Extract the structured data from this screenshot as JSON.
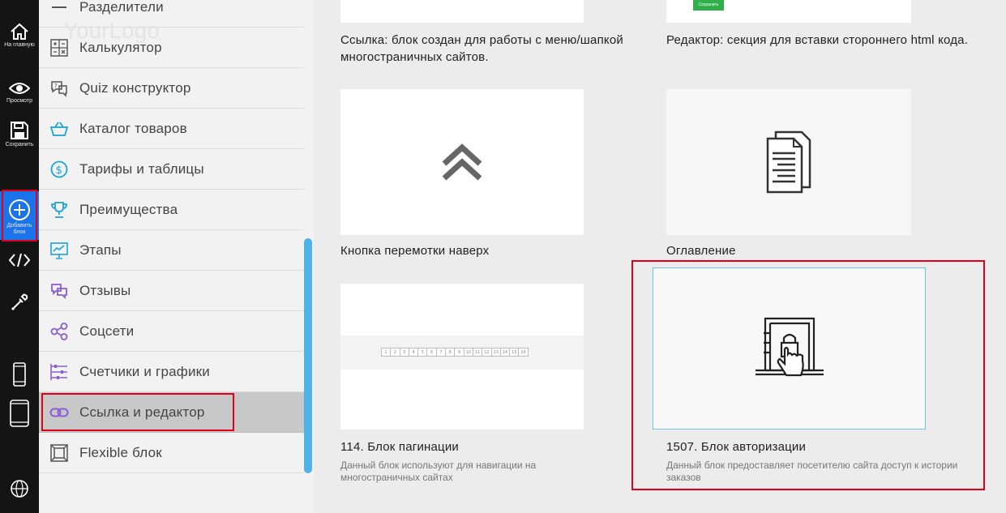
{
  "toolbar": {
    "home_label": "На главную",
    "preview_label": "Просмотр",
    "save_label": "Сохранить",
    "add_block_label": "Добавить блок"
  },
  "categories": [
    {
      "label": "Разделители",
      "icon": "divider-icon"
    },
    {
      "label": "Калькулятор",
      "icon": "calculator-icon"
    },
    {
      "label": "Quiz конструктор",
      "icon": "quiz-icon"
    },
    {
      "label": "Каталог товаров",
      "icon": "basket-icon"
    },
    {
      "label": "Тарифы и таблицы",
      "icon": "dollar-icon"
    },
    {
      "label": "Преимущества",
      "icon": "trophy-icon"
    },
    {
      "label": "Этапы",
      "icon": "chart-board-icon"
    },
    {
      "label": "Отзывы",
      "icon": "chat-icon"
    },
    {
      "label": "Соцсети",
      "icon": "share-icon"
    },
    {
      "label": "Счетчики и графики",
      "icon": "sliders-icon"
    },
    {
      "label": "Ссылка и редактор",
      "icon": "link-icon"
    },
    {
      "label": "Flexible блок",
      "icon": "flexible-icon"
    }
  ],
  "background": {
    "logo": "YourLogo"
  },
  "blocks": {
    "link": {
      "title": "Ссылка: блок создан для работы с меню/шапкой многостраничных сайтов."
    },
    "editor": {
      "title": "Редактор: секция для вставки стороннего html кода.",
      "button_label": "Сохранить"
    },
    "scroll_top": {
      "title": "Кнопка перемотки наверх"
    },
    "toc": {
      "title": "Оглавление"
    },
    "pagination": {
      "title": "114. Блок пагинации",
      "desc": "Данный блок используют для навигации на многостраничных сайтах",
      "pages": [
        "1",
        "2",
        "3",
        "4",
        "5",
        "6",
        "7",
        "8",
        "9",
        "10",
        "11",
        "12",
        "13",
        "14",
        "15",
        "16"
      ]
    },
    "auth": {
      "title": "1507. Блок авторизации",
      "desc": "Данный блок предоставляет посетителю сайта доступ к истории заказов"
    }
  },
  "colors": {
    "accent": "#1a73e8",
    "highlight": "#e0001b",
    "scroll": "#4db3e8",
    "editor_button": "#2fb04a"
  }
}
